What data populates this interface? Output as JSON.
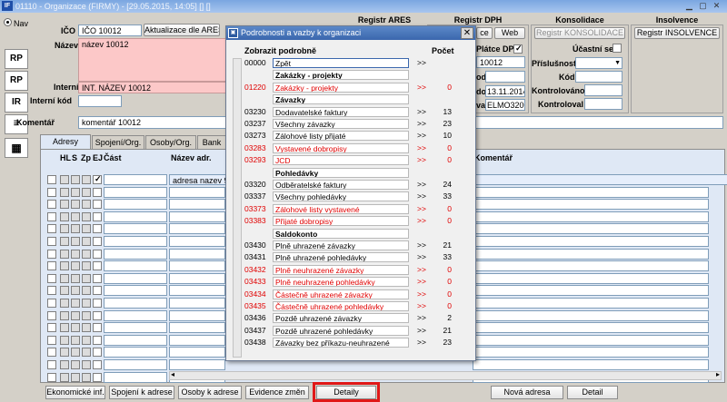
{
  "window": {
    "title": "01110 - Organizace (FIRMY) - [29.05.2015, 14:05] [] []",
    "app_icon": "IF"
  },
  "nav_label": "Nav",
  "side_buttons": [
    "RP",
    "RP",
    "IR"
  ],
  "form": {
    "ico_label": "IČO",
    "ico_value": "IČO 10012",
    "ares_button": "Aktualizace dle ARES",
    "plati_label": "Plátce",
    "nazev_label": "Název",
    "nazev_value": "název 10012",
    "interni_label": "Interní",
    "interni_value": "INT. NÁZEV 10012",
    "interni_kod_label": "Interní kód",
    "komentar_label": "Komentář",
    "komentar_value": "komentář 10012"
  },
  "groups": {
    "ares": {
      "title": "Registr ARES"
    },
    "dph": {
      "title": "Registr DPH",
      "web_button": "Web",
      "cutoff_button": "ce",
      "platce_label": "Plátce DPH",
      "v1": "10012",
      "l2": "od",
      "v3_label": "do",
      "v3": "13.11.2014",
      "l4": "val",
      "v4": "ELMO3200"
    },
    "konsolidace": {
      "title": "Konsolidace",
      "button": "Registr KONSOLIDACE",
      "ucastni_label": "Účastní se",
      "prislusnost_label": "Příslušnost",
      "kod_label": "Kód",
      "kontrolovano_label": "Kontrolováno",
      "kontroloval_label": "Kontroloval"
    },
    "insolvence": {
      "title": "Insolvence",
      "button": "Registr INSOLVENCE"
    }
  },
  "tabs": [
    "Adresy",
    "Spojení/Org.",
    "Osoby/Org.",
    "Bank"
  ],
  "grid": {
    "headers": {
      "hl": "HL",
      "s": "S",
      "zp": "Zp",
      "ej": "EJ",
      "cast": "Část",
      "nazev": "Název adr.",
      "komentar": "Komentář"
    },
    "first_row_name": "adresa nazev 90"
  },
  "dialog": {
    "title": "Podrobnosti a vazby k organizaci",
    "col_zobrazit": "Zobrazit podrobně",
    "col_pocet": "Počet",
    "rows": [
      {
        "code": "00000",
        "name": "Zpět",
        "arrow": ">>",
        "count": "",
        "red": false,
        "section": false
      },
      {
        "code": "",
        "name": "Zakázky - projekty",
        "arrow": "",
        "count": "",
        "red": false,
        "section": true
      },
      {
        "code": "01220",
        "name": "Zakázky - projekty",
        "arrow": ">>",
        "count": "0",
        "red": true,
        "section": false
      },
      {
        "code": "",
        "name": "Závazky",
        "arrow": "",
        "count": "",
        "red": false,
        "section": true
      },
      {
        "code": "03230",
        "name": "Dodavatelské faktury",
        "arrow": ">>",
        "count": "13",
        "red": false,
        "section": false
      },
      {
        "code": "03237",
        "name": "Všechny závazky",
        "arrow": ">>",
        "count": "23",
        "red": false,
        "section": false
      },
      {
        "code": "03273",
        "name": "Zálohové listy přijaté",
        "arrow": ">>",
        "count": "10",
        "red": false,
        "section": false
      },
      {
        "code": "03283",
        "name": "Vystavené dobropisy",
        "arrow": ">>",
        "count": "0",
        "red": true,
        "section": false
      },
      {
        "code": "03293",
        "name": "JCD",
        "arrow": ">>",
        "count": "0",
        "red": true,
        "section": false
      },
      {
        "code": "",
        "name": "Pohledávky",
        "arrow": "",
        "count": "",
        "red": false,
        "section": true
      },
      {
        "code": "03320",
        "name": "Odběratelské faktury",
        "arrow": ">>",
        "count": "24",
        "red": false,
        "section": false
      },
      {
        "code": "03337",
        "name": "Všechny pohledávky",
        "arrow": ">>",
        "count": "33",
        "red": false,
        "section": false
      },
      {
        "code": "03373",
        "name": "Zálohové listy vystavené",
        "arrow": ">>",
        "count": "0",
        "red": true,
        "section": false
      },
      {
        "code": "03383",
        "name": "Přijaté dobropisy",
        "arrow": ">>",
        "count": "0",
        "red": true,
        "section": false
      },
      {
        "code": "",
        "name": "Saldokonto",
        "arrow": "",
        "count": "",
        "red": false,
        "section": true
      },
      {
        "code": "03430",
        "name": "Plně uhrazené závazky",
        "arrow": ">>",
        "count": "21",
        "red": false,
        "section": false
      },
      {
        "code": "03431",
        "name": "Plně uhrazené pohledávky",
        "arrow": ">>",
        "count": "33",
        "red": false,
        "section": false
      },
      {
        "code": "03432",
        "name": "Plně neuhrazené závazky",
        "arrow": ">>",
        "count": "0",
        "red": true,
        "section": false
      },
      {
        "code": "03433",
        "name": "Plně neuhrazené pohledávky",
        "arrow": ">>",
        "count": "0",
        "red": true,
        "section": false
      },
      {
        "code": "03434",
        "name": "Částečně uhrazené závazky",
        "arrow": ">>",
        "count": "0",
        "red": true,
        "section": false
      },
      {
        "code": "03435",
        "name": "Částečně uhrazené pohledávky",
        "arrow": ">>",
        "count": "0",
        "red": true,
        "section": false
      },
      {
        "code": "03436",
        "name": "Pozdě uhrazené závazky",
        "arrow": ">>",
        "count": "2",
        "red": false,
        "section": false
      },
      {
        "code": "03437",
        "name": "Pozdě uhrazené pohledávky",
        "arrow": ">>",
        "count": "21",
        "red": false,
        "section": false
      },
      {
        "code": "03438",
        "name": "Závazky bez příkazu-neuhrazené",
        "arrow": ">>",
        "count": "23",
        "red": false,
        "section": false
      }
    ]
  },
  "bottom_buttons": {
    "ekonomicke": "Ekonomické inf.",
    "spojeni": "Spojení k adrese",
    "osoby": "Osoby k adrese",
    "evidence": "Evidence změn",
    "detaily": "Detaily",
    "nova_adresa": "Nová adresa",
    "detail": "Detail"
  },
  "colors": {
    "highlight_red": "#e00000",
    "pink_field": "#fcc8c8",
    "dialog_title": "#3b67ad"
  }
}
